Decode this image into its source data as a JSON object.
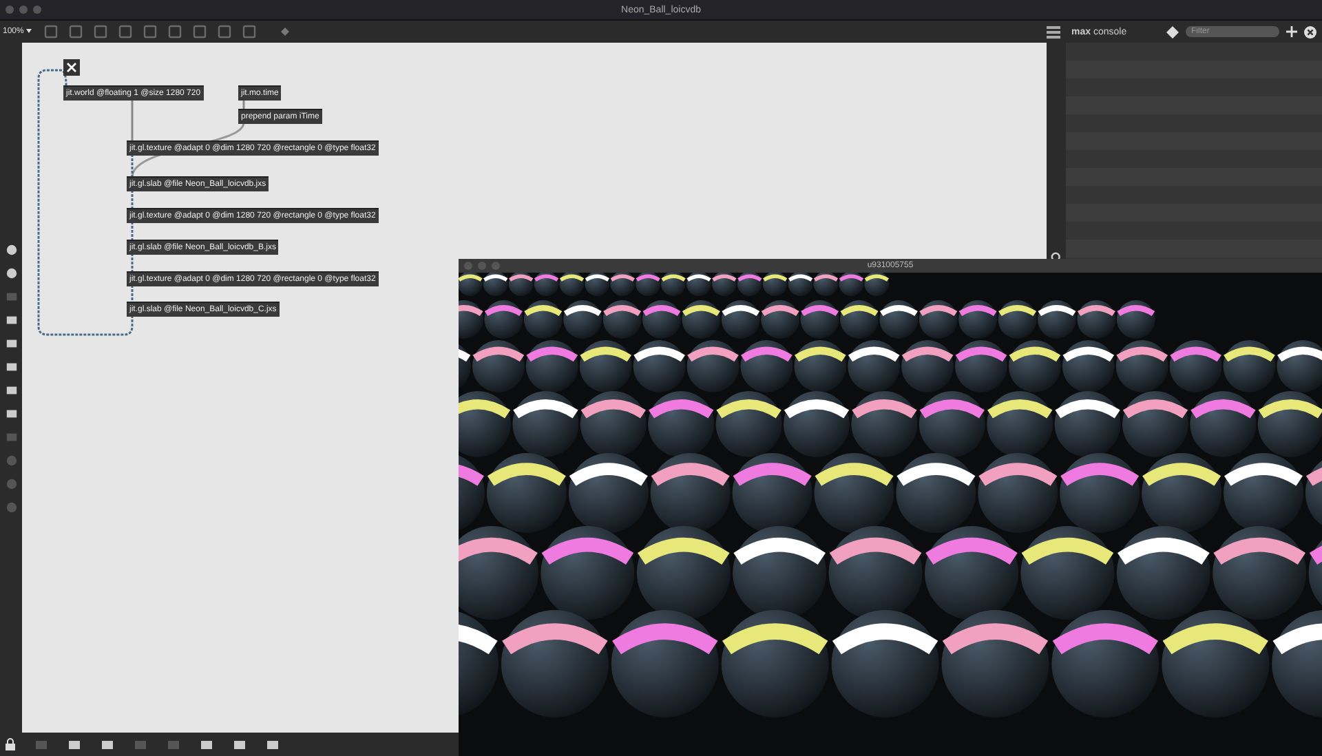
{
  "window": {
    "title": "Neon_Ball_loicvdb"
  },
  "toolbar": {
    "zoom": "100%"
  },
  "patch": {
    "toggle": {
      "checked": true
    },
    "objects": [
      {
        "text": "jit.world @floating 1 @size 1280 720"
      },
      {
        "text": "jit.mo.time"
      },
      {
        "text": "prepend param iTime"
      },
      {
        "text": "jit.gl.texture @adapt 0 @dim 1280 720 @rectangle 0 @type float32"
      },
      {
        "text": "jit.gl.slab @file Neon_Ball_loicvdb.jxs"
      },
      {
        "text": "jit.gl.texture @adapt 0 @dim 1280 720 @rectangle 0 @type float32"
      },
      {
        "text": "jit.gl.slab @file Neon_Ball_loicvdb_B.jxs"
      },
      {
        "text": "jit.gl.texture @adapt 0 @dim 1280 720 @rectangle 0 @type float32"
      },
      {
        "text": "jit.gl.slab @file Neon_Ball_loicvdb_C.jxs"
      }
    ]
  },
  "console": {
    "title_bold": "max",
    "title": "console",
    "search": {
      "placeholder": "Filter"
    }
  },
  "render_window": {
    "title": "u931005755"
  }
}
